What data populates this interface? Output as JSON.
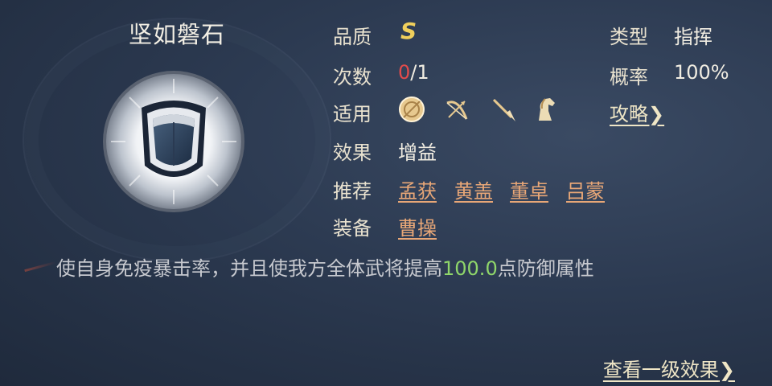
{
  "skill": {
    "name": "坚如磐石",
    "icon": "shield-icon"
  },
  "fields": {
    "quality_label": "品质",
    "quality_value": "S",
    "count_label": "次数",
    "count_used": "0",
    "count_total": "/1",
    "apply_label": "适用",
    "apply_units": [
      "shield-unit-icon",
      "bow-unit-icon",
      "spear-unit-icon",
      "cavalry-unit-icon"
    ],
    "effect_label": "效果",
    "effect_value": "增益",
    "recommend_label": "推荐",
    "recommend": [
      "孟获",
      "黄盖",
      "董卓",
      "吕蒙"
    ],
    "equip_label": "装备",
    "equip_value": "曹操",
    "type_label": "类型",
    "type_value": "指挥",
    "rate_label": "概率",
    "rate_value": "100%",
    "guide_link": "攻略"
  },
  "description": {
    "before": "使自身免疫暴击率，并且使我方全体武将提高",
    "value": "100.0",
    "after": "点防御属性"
  },
  "footer": {
    "more_link": "查看一级效果"
  },
  "colors": {
    "grade": "#f0cf5c",
    "count_used": "#e24b4b",
    "link": "#e8a777",
    "value_green": "#8fd66a"
  }
}
